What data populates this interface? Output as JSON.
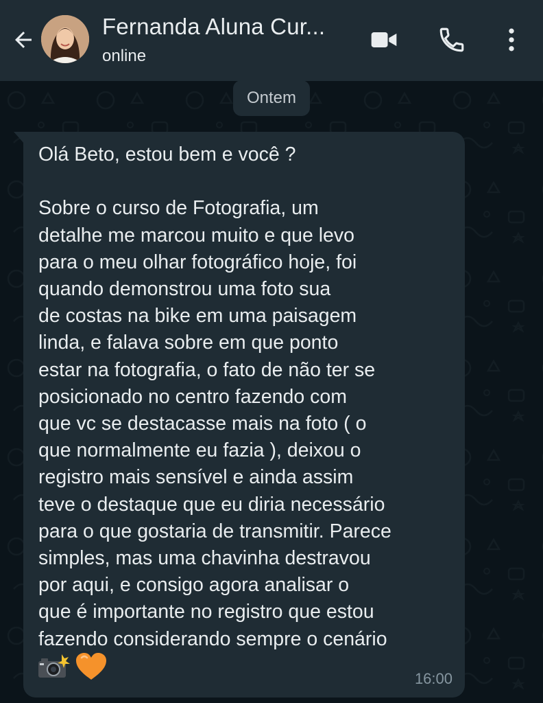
{
  "header": {
    "contact_name": "Fernanda Aluna Cur...",
    "status": "online",
    "icons": {
      "back": "arrow-left-icon",
      "video": "video-camera-icon",
      "call": "phone-icon",
      "menu": "kebab-menu-icon"
    }
  },
  "chat": {
    "date_divider": "Ontem",
    "messages": [
      {
        "text": "Olá Beto, estou bem e você ?\n\nSobre o curso de Fotografia, um\ndetalhe me marcou muito e que levo\npara o meu olhar fotográfico hoje, foi\nquando demonstrou uma foto sua\nde costas na bike em uma paisagem\nlinda, e falava sobre em que ponto\nestar na fotografia, o fato de não ter se\nposicionado no centro fazendo com\nque vc se destacasse mais na foto ( o\nque normalmente eu fazia ), deixou o\nregistro mais sensível e ainda assim\nteve o destaque que eu diria necessário\npara o que gostaria de transmitir. Parece\nsimples, mas uma chavinha destravou\npor aqui, e consigo agora analisar o\nque é importante no registro que estou\nfazendo considerando sempre o cenário",
        "emojis": [
          "camera-with-flash-icon",
          "orange-heart-icon"
        ],
        "time": "16:00"
      }
    ]
  },
  "colors": {
    "header_bg": "#1f2c34",
    "chat_bg": "#0b141a",
    "bubble_bg": "#1f2c34",
    "text_primary": "#e9edef",
    "text_secondary": "#8696a0"
  }
}
